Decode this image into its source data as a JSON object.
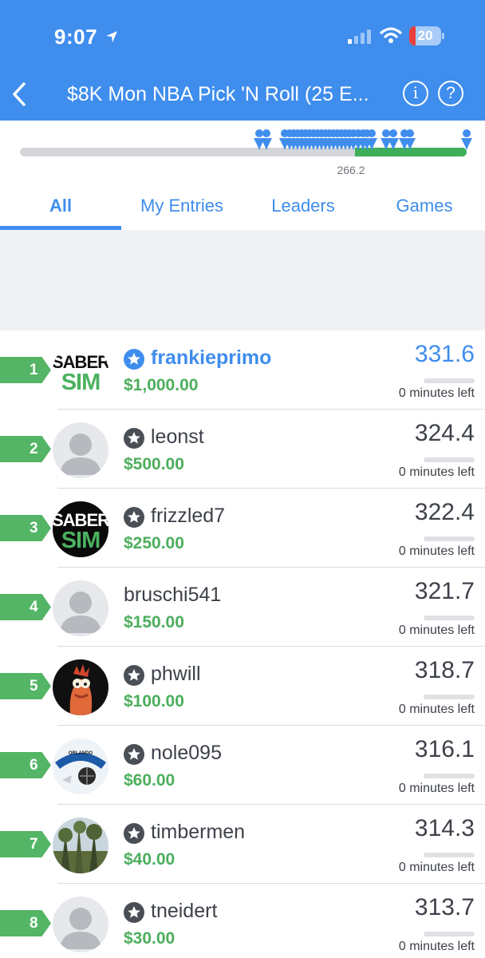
{
  "status_bar": {
    "time": "9:07",
    "battery_level": "20"
  },
  "nav": {
    "title": "$8K Mon NBA Pick 'N Roll (25 E...",
    "info_icon": "i",
    "help_icon": "?"
  },
  "progress": {
    "label": "266.2",
    "fill_fraction": 0.25
  },
  "tabs": [
    {
      "label": "All",
      "active": true
    },
    {
      "label": "My Entries",
      "active": false
    },
    {
      "label": "Leaders",
      "active": false
    },
    {
      "label": "Games",
      "active": false
    }
  ],
  "logo": {
    "line1": "SABER",
    "line2": "SIM"
  },
  "colors": {
    "brand_blue": "#3f8ded",
    "rank_green": "#53b565",
    "prize_green": "#4cae5c"
  },
  "leaderboard": [
    {
      "rank": "1",
      "name": "frankieprimo",
      "prize": "$1,000.00",
      "score": "331.6",
      "time_left": "0 minutes left",
      "starred": true,
      "highlighted": true,
      "avatar": "sabersim-logo-white"
    },
    {
      "rank": "2",
      "name": "leonst",
      "prize": "$500.00",
      "score": "324.4",
      "time_left": "0 minutes left",
      "starred": true,
      "highlighted": false,
      "avatar": "default-avatar"
    },
    {
      "rank": "3",
      "name": "frizzled7",
      "prize": "$250.00",
      "score": "322.4",
      "time_left": "0 minutes left",
      "starred": true,
      "highlighted": false,
      "avatar": "sabersim-logo-black"
    },
    {
      "rank": "4",
      "name": "bruschi541",
      "prize": "$150.00",
      "score": "321.7",
      "time_left": "0 minutes left",
      "starred": false,
      "highlighted": false,
      "avatar": "default-avatar"
    },
    {
      "rank": "5",
      "name": "phwill",
      "prize": "$100.00",
      "score": "318.7",
      "time_left": "0 minutes left",
      "starred": true,
      "highlighted": false,
      "avatar": "muppet-photo"
    },
    {
      "rank": "6",
      "name": "nole095",
      "prize": "$60.00",
      "score": "316.1",
      "time_left": "0 minutes left",
      "starred": true,
      "highlighted": false,
      "avatar": "orlando-magic-logo"
    },
    {
      "rank": "7",
      "name": "timbermen",
      "prize": "$40.00",
      "score": "314.3",
      "time_left": "0 minutes left",
      "starred": true,
      "highlighted": false,
      "avatar": "forest-photo"
    },
    {
      "rank": "8",
      "name": "tneidert",
      "prize": "$30.00",
      "score": "313.7",
      "time_left": "0 minutes left",
      "starred": true,
      "highlighted": false,
      "avatar": "default-avatar"
    }
  ]
}
